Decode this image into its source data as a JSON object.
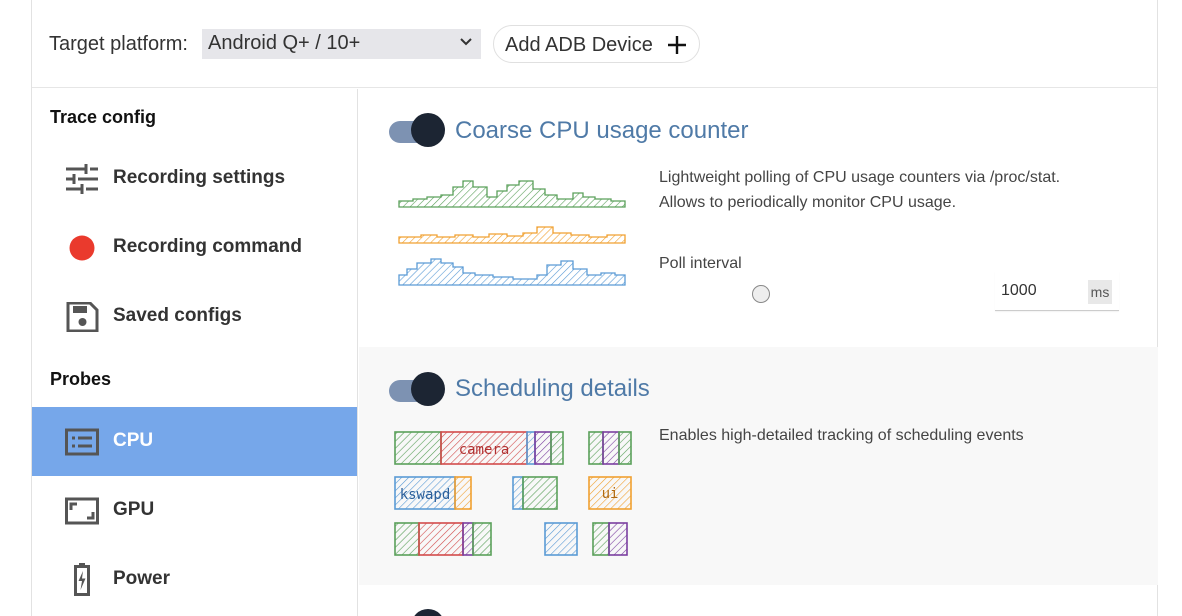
{
  "header": {
    "platform_label": "Target platform:",
    "platform_value": "Android Q+ / 10+",
    "add_adb_label": "Add ADB Device"
  },
  "sidebar": {
    "trace_config_title": "Trace config",
    "probes_title": "Probes",
    "items": [
      {
        "label": "Recording settings",
        "icon": "tune-icon"
      },
      {
        "label": "Recording command",
        "icon": "record-dot-icon"
      },
      {
        "label": "Saved configs",
        "icon": "save-icon"
      }
    ],
    "probes": [
      {
        "label": "CPU",
        "icon": "cpu-icon",
        "active": true
      },
      {
        "label": "GPU",
        "icon": "gpu-icon",
        "active": false
      },
      {
        "label": "Power",
        "icon": "battery-icon",
        "active": false
      }
    ]
  },
  "probes": [
    {
      "title": "Coarse CPU usage counter",
      "enabled": true,
      "description_line1": "Lightweight polling of CPU usage counters via /proc/stat.",
      "description_line2": "Allows to periodically monitor CPU usage.",
      "slider_label": "Poll interval",
      "poll_value": "1000",
      "unit": "ms"
    },
    {
      "title": "Scheduling details",
      "enabled": true,
      "description": "Enables high-detailed tracking of scheduling events",
      "illustration_labels": [
        "camera",
        "kswapd",
        "ui"
      ]
    }
  ],
  "colors": {
    "accent": "#76a7ea",
    "title": "#4f7aa7",
    "toggle_track": "#7d92b2",
    "toggle_knob": "#1c2533",
    "green": "#5aa05a",
    "orange": "#f0a030",
    "blue": "#5b9bd5",
    "red": "#d24b4b",
    "purple": "#7b3fa0"
  }
}
